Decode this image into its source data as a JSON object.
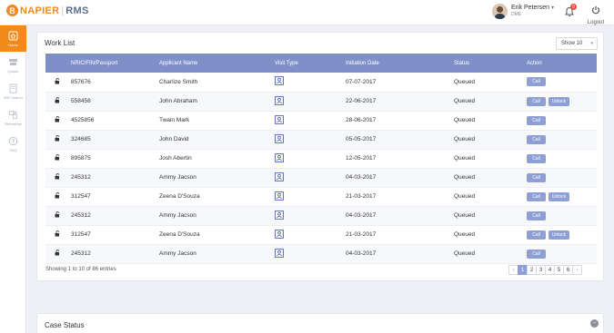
{
  "header": {
    "logo_mark": "B",
    "logo_brand": "NAPIER",
    "logo_sep": "|",
    "logo_product": "RMS",
    "user_name": "Erik Petersen",
    "user_role": "DME",
    "notification_count": "0",
    "logout_label": "Logout"
  },
  "sidebar": {
    "items": [
      {
        "label": "Home",
        "icon": "home-icon",
        "active": true
      },
      {
        "label": "Queue",
        "icon": "queue-icon"
      },
      {
        "label": "WR Search",
        "icon": "document-search-icon"
      },
      {
        "label": "Reference",
        "icon": "reference-icon"
      },
      {
        "label": "FAQ",
        "icon": "faq-icon"
      }
    ]
  },
  "worklist": {
    "title": "Work List",
    "show_select": "Show 10",
    "columns": [
      "NRIC/FIN/Passport",
      "Applicant Name",
      "Visit Type",
      "Initiation Date",
      "Status",
      "Action"
    ],
    "rows": [
      {
        "id": "857676",
        "name": "Charlize Smith",
        "date": "07-07-2017",
        "status": "Queued",
        "actions": [
          "Call"
        ]
      },
      {
        "id": "558458",
        "name": "John Abraham",
        "date": "22-06-2017",
        "status": "Queued",
        "actions": [
          "Call",
          "Unlock"
        ]
      },
      {
        "id": "4525856",
        "name": "Twain Mark",
        "date": "28-06-2017",
        "status": "Queued",
        "actions": [
          "Call"
        ]
      },
      {
        "id": "324685",
        "name": "John David",
        "date": "05-05-2017",
        "status": "Queued",
        "actions": [
          "Call"
        ]
      },
      {
        "id": "895875",
        "name": "Josh Abertin",
        "date": "12-05-2017",
        "status": "Queued",
        "actions": [
          "Call"
        ]
      },
      {
        "id": "245312",
        "name": "Ammy Jacson",
        "date": "04-03-2017",
        "status": "Queued",
        "actions": [
          "Call"
        ]
      },
      {
        "id": "312547",
        "name": "Zeena D'Souza",
        "date": "21-03-2017",
        "status": "Queued",
        "actions": [
          "Call",
          "Unlock"
        ]
      },
      {
        "id": "245312",
        "name": "Ammy Jacson",
        "date": "04-03-2017",
        "status": "Queued",
        "actions": [
          "Call"
        ]
      },
      {
        "id": "312547",
        "name": "Zeena D'Souza",
        "date": "21-03-2017",
        "status": "Queued",
        "actions": [
          "Call",
          "Unlock"
        ]
      },
      {
        "id": "245312",
        "name": "Ammy Jacson",
        "date": "04-03-2017",
        "status": "Queued",
        "actions": [
          "Call"
        ]
      }
    ],
    "entries_text": "Showing 1 to 10 of 86 entries",
    "pages": [
      "‹",
      "1",
      "2",
      "3",
      "4",
      "5",
      "6",
      "›"
    ],
    "active_page": "1"
  },
  "case_status": {
    "title": "Case Status"
  },
  "colors": {
    "brand_orange": "#f08a1a",
    "header_blue": "#7f90c8",
    "button_blue": "#8e9fd6"
  }
}
